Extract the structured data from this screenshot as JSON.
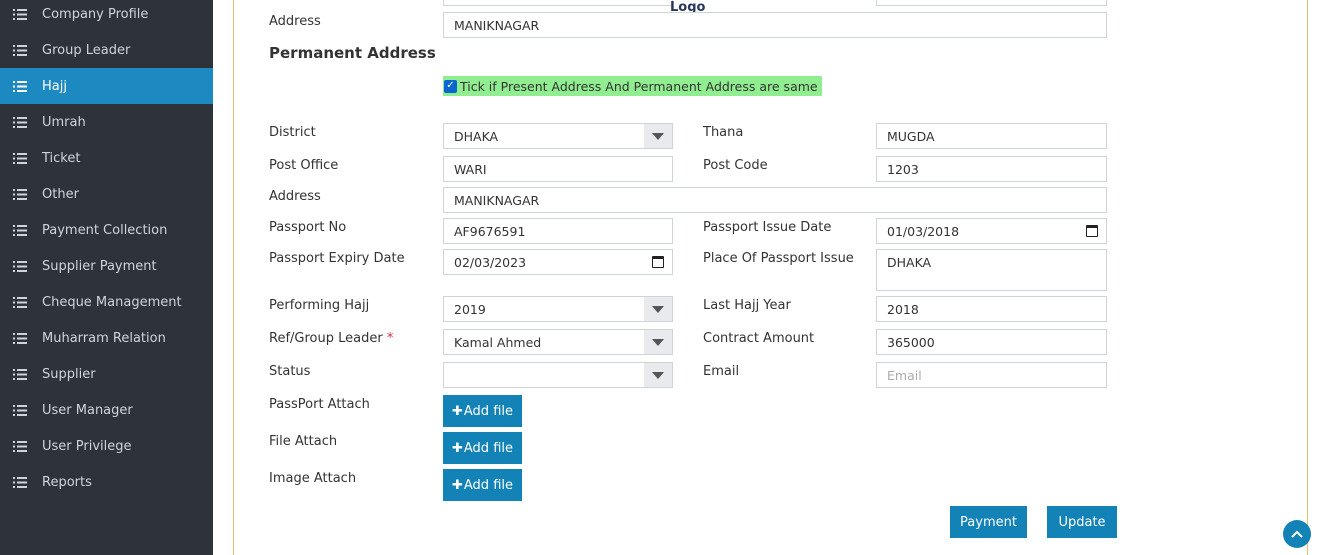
{
  "sidebar": {
    "items": [
      {
        "label": "Company Profile"
      },
      {
        "label": "Group Leader"
      },
      {
        "label": "Hajj"
      },
      {
        "label": "Umrah"
      },
      {
        "label": "Ticket"
      },
      {
        "label": "Other"
      },
      {
        "label": "Payment Collection"
      },
      {
        "label": "Supplier Payment"
      },
      {
        "label": "Cheque Management"
      },
      {
        "label": "Muharram Relation"
      },
      {
        "label": "Supplier"
      },
      {
        "label": "User Manager"
      },
      {
        "label": "User Privilege"
      },
      {
        "label": "Reports"
      }
    ],
    "active_item": "Hajj",
    "icon": "list-icon"
  },
  "header": {
    "logo_text": "Logo"
  },
  "present": {
    "address_label": "Address",
    "address_value": "MANIKNAGAR"
  },
  "permanent": {
    "section_title": "Permanent Address",
    "same_checkbox_label": "Tick if Present Address And Permanent Address are same",
    "same_checked": true,
    "district_label": "District",
    "district_value": "DHAKA",
    "thana_label": "Thana",
    "thana_value": "MUGDA",
    "post_office_label": "Post Office",
    "post_office_value": "WARI",
    "post_code_label": "Post Code",
    "post_code_value": "1203",
    "address_label": "Address",
    "address_value": "MANIKNAGAR"
  },
  "passport": {
    "no_label": "Passport No",
    "no_value": "AF9676591",
    "issue_date_label": "Passport Issue Date",
    "issue_date_value": "01/03/2018",
    "expiry_label": "Passport Expiry Date",
    "expiry_value": "02/03/2023",
    "place_label": "Place Of Passport Issue",
    "place_value": "DHAKA"
  },
  "hajj": {
    "performing_label": "Performing Hajj",
    "performing_value": "2019",
    "last_year_label": "Last Hajj Year",
    "last_year_value": "2018",
    "ref_label": "Ref/Group Leader",
    "ref_required": "*",
    "ref_value": "Kamal Ahmed",
    "contract_label": "Contract Amount",
    "contract_value": "365000",
    "status_label": "Status",
    "status_value": "",
    "email_label": "Email",
    "email_placeholder": "Email"
  },
  "attachments": {
    "passport_label": "PassPort Attach",
    "file_label": "File Attach",
    "image_label": "Image Attach",
    "add_file_label": "Add file"
  },
  "actions": {
    "payment_label": "Payment",
    "update_label": "Update"
  },
  "colors": {
    "sidebar_bg": "#2d3339",
    "active_bg": "#1c8ac1",
    "button_bg": "#1382b6",
    "checkbox_highlight": "#90ee90"
  }
}
